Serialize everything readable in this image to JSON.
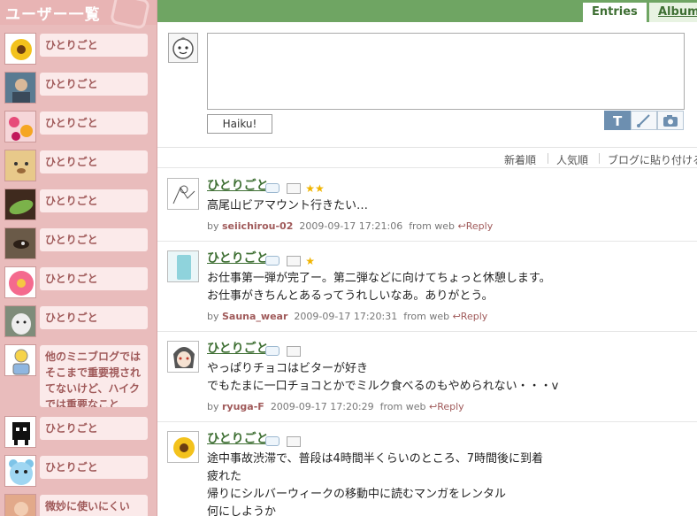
{
  "sidebar": {
    "title": "ユーザー一覧",
    "items": [
      {
        "label": "ひとりごと",
        "avatar": "sunflower-avatar"
      },
      {
        "label": "ひとりごと",
        "avatar": "person-photo-avatar"
      },
      {
        "label": "ひとりごと",
        "avatar": "flowers-avatar"
      },
      {
        "label": "ひとりごと",
        "avatar": "bear-avatar"
      },
      {
        "label": "ひとりごと",
        "avatar": "leaf-avatar"
      },
      {
        "label": "ひとりごと",
        "avatar": "animal-eye-avatar"
      },
      {
        "label": "ひとりごと",
        "avatar": "pink-flower-avatar"
      },
      {
        "label": "ひとりごと",
        "avatar": "dog-avatar"
      },
      {
        "label": "他のミニブログではそこまで重要視されてないけど、ハイクでは重要なこと",
        "avatar": "person-icon-avatar"
      },
      {
        "label": "ひとりごと",
        "avatar": "pixel-creature-avatar"
      },
      {
        "label": "ひとりごと",
        "avatar": "blue-bear-avatar"
      },
      {
        "label": "微妙に使いにくい",
        "avatar": "photo-avatar"
      }
    ]
  },
  "tabs": {
    "entries": "Entries",
    "album": "Album"
  },
  "composer": {
    "button": "Haiku!",
    "avatar_icon": "smiley-face-icon"
  },
  "sort": {
    "new": "新着順",
    "popular": "人気順",
    "embed": "ブログに貼り付ける"
  },
  "entries": [
    {
      "title": "ひとりごと",
      "stars": "★★",
      "body": [
        "高尾山ビアマウント行きたい…"
      ],
      "author": "seiichirou-02",
      "time": "2009-09-17 17:21:06",
      "source": "from web",
      "reply": "Reply"
    },
    {
      "title": "ひとりごと",
      "stars": "★",
      "body": [
        "お仕事第一弾が完了ー。第二弾などに向けてちょっと休憩します。",
        "お仕事がきちんとあるってうれしいなあ。ありがとう。"
      ],
      "author": "Sauna_wear",
      "time": "2009-09-17 17:20:31",
      "source": "from web",
      "reply": "Reply"
    },
    {
      "title": "ひとりごと",
      "stars": "",
      "body": [
        "やっぱりチョコはビターが好き",
        "でもたまに一口チョコとかでミルク食べるのもやめられない・・・v"
      ],
      "author": "ryuga-F",
      "time": "2009-09-17 17:20:29",
      "source": "from web",
      "reply": "Reply"
    },
    {
      "title": "ひとりごと",
      "stars": "",
      "body": [
        "途中事故渋滞で、普段は4時間半くらいのところ、7時間後に到着",
        "疲れた",
        "帰りにシルバーウィークの移動中に読むマンガをレンタル",
        "何にしようか"
      ],
      "author": "",
      "time": "",
      "source": "",
      "reply": ""
    }
  ]
}
